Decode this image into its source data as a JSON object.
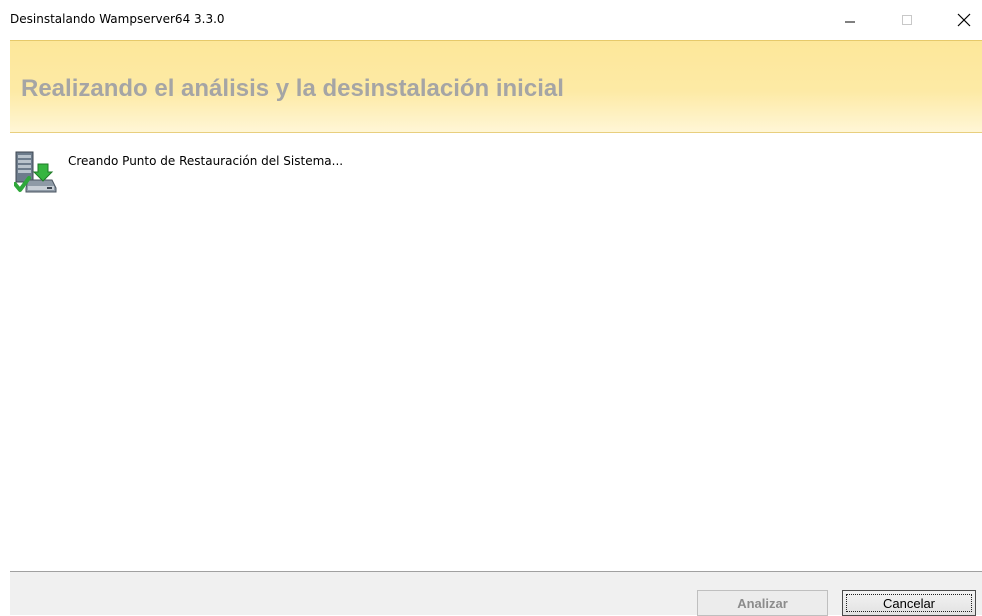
{
  "window": {
    "title": "Desinstalando Wampserver64 3.3.0",
    "controls": {
      "minimize_icon": "minimize-icon",
      "maximize_icon": "maximize-icon",
      "close_icon": "close-icon"
    }
  },
  "banner": {
    "title": "Realizando el análisis y la desinstalación inicial",
    "colors": {
      "background": "#fde79a",
      "title": "#a5a5a5"
    }
  },
  "status": {
    "icon": "restore-point-icon",
    "text": "Creando Punto de Restauración del Sistema..."
  },
  "footer": {
    "analyze_label": "Analizar",
    "analyze_enabled": false,
    "cancel_label": "Cancelar"
  }
}
